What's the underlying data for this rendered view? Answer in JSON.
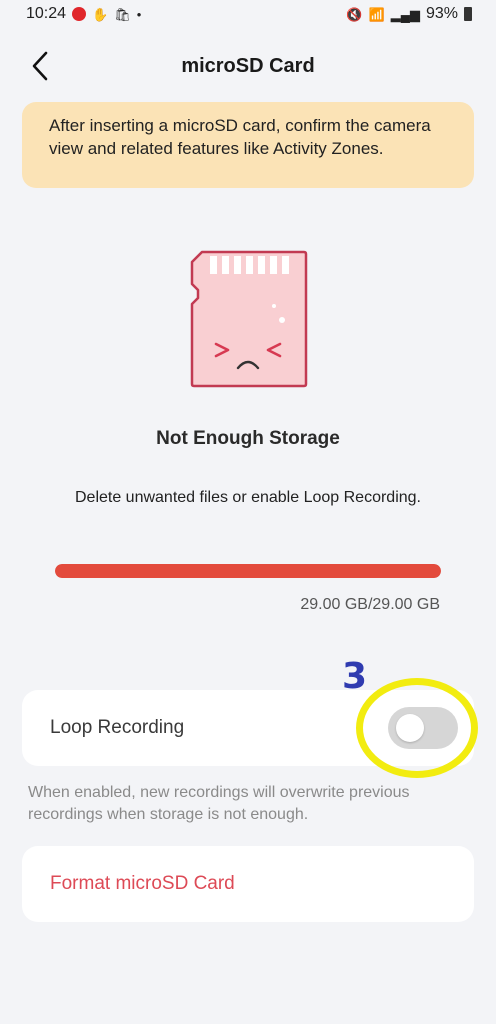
{
  "status_bar": {
    "time": "10:24",
    "battery": "93%",
    "icons": [
      "youtube-icon",
      "hand-icon",
      "shop-icon",
      "dot-icon",
      "mute-icon",
      "wifi-icon",
      "signal-icon",
      "signal-icon-2",
      "battery-icon"
    ]
  },
  "header": {
    "title": "microSD Card",
    "back_icon": "chevron-left-icon"
  },
  "banner": {
    "text": "After inserting a microSD card, confirm the camera view and related features like Activity Zones."
  },
  "storage": {
    "title": "Not Enough Storage",
    "description": "Delete unwanted files or enable Loop Recording.",
    "usage_text": "29.00 GB/29.00 GB",
    "used_fraction": 1.0,
    "bar_color": "#e34a3c"
  },
  "annotation": {
    "number": "3"
  },
  "loop_recording": {
    "label": "Loop Recording",
    "enabled": false,
    "help_text": "When enabled, new recordings will overwrite previous recordings when storage is not enough."
  },
  "format": {
    "label": "Format microSD Card",
    "color": "#dd4a56"
  }
}
